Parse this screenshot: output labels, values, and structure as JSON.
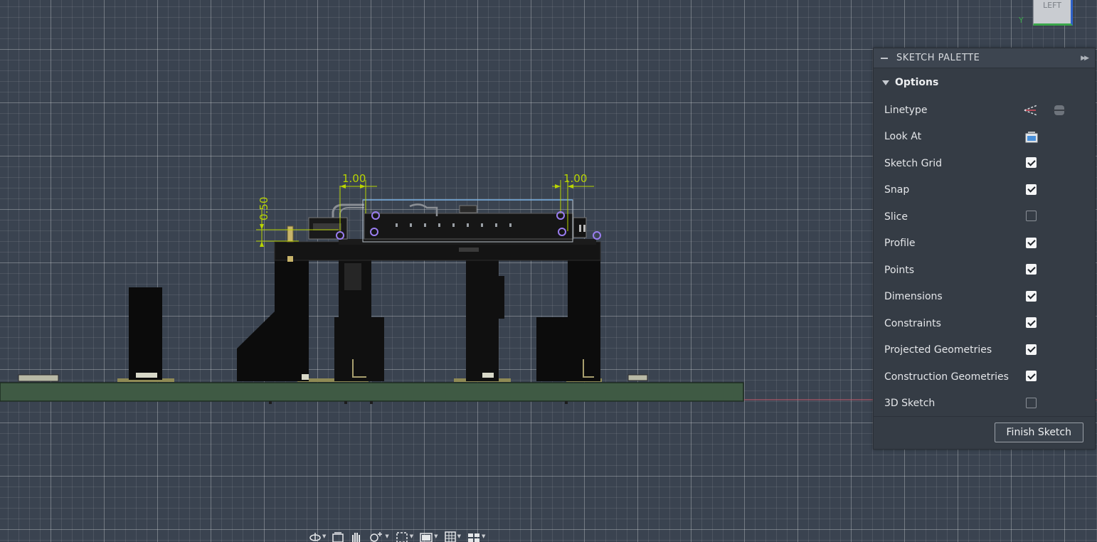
{
  "viewport": {
    "viewcube_face": "LEFT",
    "axis_label": "Y",
    "dimensions": {
      "left_horizontal": "1.00",
      "right_horizontal": "1.00",
      "vertical": "0.50"
    }
  },
  "palette": {
    "title": "SKETCH PALETTE",
    "options_label": "Options",
    "rows": [
      {
        "label": "Linetype",
        "control": "icons"
      },
      {
        "label": "Look At",
        "control": "icon"
      },
      {
        "label": "Sketch Grid",
        "checked": true
      },
      {
        "label": "Snap",
        "checked": true
      },
      {
        "label": "Slice",
        "checked": false
      },
      {
        "label": "Profile",
        "checked": true
      },
      {
        "label": "Points",
        "checked": true
      },
      {
        "label": "Dimensions",
        "checked": true
      },
      {
        "label": "Constraints",
        "checked": true
      },
      {
        "label": "Projected Geometries",
        "checked": true
      },
      {
        "label": "Construction Geometries",
        "checked": true
      },
      {
        "label": "3D Sketch",
        "checked": false
      }
    ],
    "finish_label": "Finish Sketch"
  },
  "navbar": {
    "items": [
      "orbit-icon",
      "look-at-icon",
      "pan-icon",
      "zoom-icon",
      "fit-icon",
      "display-settings-icon",
      "grid-icon",
      "viewports-icon"
    ]
  },
  "colors": {
    "dimension": "#b8d400",
    "constraint_point": "#9a7df0",
    "board": "#3f5a44",
    "background": "#3a4350"
  }
}
